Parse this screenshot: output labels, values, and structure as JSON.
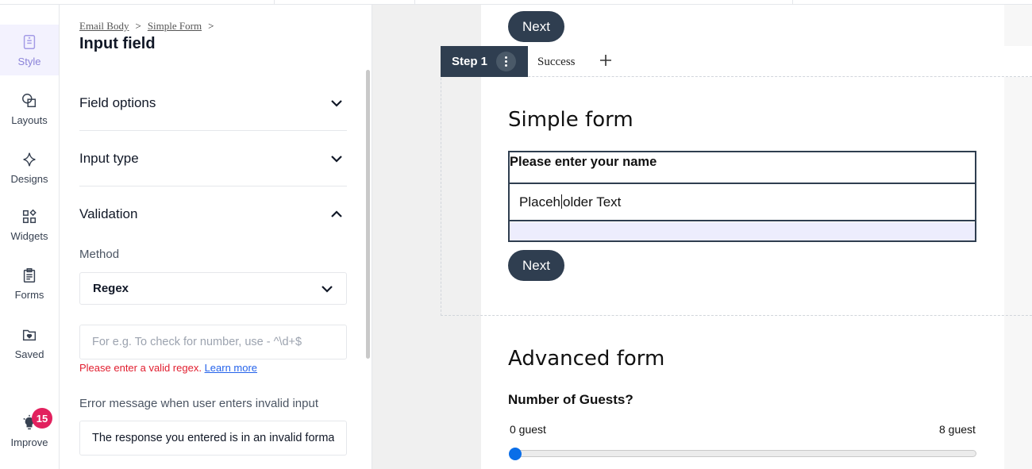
{
  "rail": {
    "items": [
      {
        "label": "Style",
        "icon": "style-icon"
      },
      {
        "label": "Layouts",
        "icon": "layouts-icon"
      },
      {
        "label": "Designs",
        "icon": "designs-icon"
      },
      {
        "label": "Widgets",
        "icon": "widgets-icon"
      },
      {
        "label": "Forms",
        "icon": "forms-icon"
      },
      {
        "label": "Saved",
        "icon": "saved-icon"
      },
      {
        "label": "Improve",
        "icon": "lightbulb-icon"
      }
    ],
    "badge": "15",
    "accent": "#8b83d9",
    "badge_color": "#e2215e"
  },
  "panel": {
    "breadcrumb": [
      "Email Body",
      "Simple Form"
    ],
    "breadcrumb_sep": ">",
    "title": "Input field",
    "sections": [
      "Field options",
      "Input type",
      "Validation"
    ],
    "method_label": "Method",
    "method_value": "Regex",
    "regex_placeholder": "For e.g. To check for number, use - ^\\d+$",
    "error_text": "Please enter a valid regex.",
    "learn_more": "Learn more",
    "error_msg_label": "Error message when user enters invalid input",
    "error_msg_value": "The response you entered is in an invalid format."
  },
  "canvas": {
    "next_label": "Next",
    "tabs": {
      "step": "Step 1",
      "success": "Success"
    },
    "simple_title": "Simple form",
    "name_label": "Please enter your name",
    "placeholder_before": "Placeh",
    "placeholder_after": "older Text",
    "advanced_title": "Advanced form",
    "guests_title": "Number of Guests?",
    "range_min": "0 guest",
    "range_max": "8 guest",
    "slider_value": 0,
    "button_color": "#2f3e50",
    "slider_color": "#0a6ee8"
  }
}
